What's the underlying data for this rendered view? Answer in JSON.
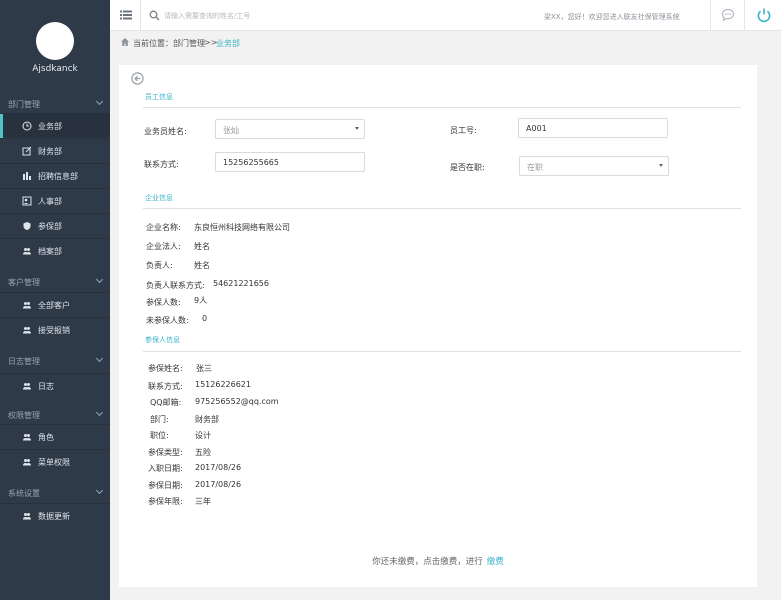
{
  "user": {
    "name": "Ajsdkanck"
  },
  "sidebar": {
    "groups": [
      {
        "label": "部门管理",
        "items": [
          {
            "label": "业务部",
            "icon": "clock-icon",
            "active": true
          },
          {
            "label": "财务部",
            "icon": "edit-icon"
          },
          {
            "label": "招聘信息部",
            "icon": "chart-icon"
          },
          {
            "label": "人事部",
            "icon": "id-card-icon"
          },
          {
            "label": "参保部",
            "icon": "shield-icon"
          },
          {
            "label": "档案部",
            "icon": "users-icon"
          }
        ]
      },
      {
        "label": "客户管理",
        "items": [
          {
            "label": "全部客户",
            "icon": "users-icon"
          },
          {
            "label": "接受报销",
            "icon": "users-icon"
          }
        ]
      },
      {
        "label": "日志管理",
        "items": [
          {
            "label": "日志",
            "icon": "users-icon"
          }
        ]
      },
      {
        "label": "权限管理",
        "items": [
          {
            "label": "角色",
            "icon": "users-icon"
          },
          {
            "label": "菜单权限",
            "icon": "users-icon"
          }
        ]
      },
      {
        "label": "系统设置",
        "items": [
          {
            "label": "数据更新",
            "icon": "users-icon"
          }
        ]
      }
    ]
  },
  "topbar": {
    "search_placeholder": "请输入需要查询的姓名/工号",
    "welcome": "梁XX，您好！欢迎您进入联友社保管理系统"
  },
  "breadcrumb": {
    "prefix": "当前位置：",
    "section": "部门管理",
    "separator": ">>",
    "current": "业务部"
  },
  "employee": {
    "title": "员工信息",
    "name_label": "业务员姓名:",
    "name_value": "张灿",
    "id_label": "员工号:",
    "id_value": "A001",
    "phone_label": "联系方式:",
    "phone_value": "15256255665",
    "status_label": "是否在职:",
    "status_value": "在职"
  },
  "company": {
    "title": "企业信息",
    "rows": [
      {
        "label": "企业名称:",
        "value": "东良恒州科技网络有限公司"
      },
      {
        "label": "企业法人:",
        "value": "姓名"
      },
      {
        "label": "负责人:",
        "value": "姓名"
      },
      {
        "label": "负责人联系方式:",
        "value": "54621221656"
      },
      {
        "label": "参保人数:",
        "value": "9人"
      },
      {
        "label": "未参保人数:",
        "value": "0"
      }
    ]
  },
  "insured": {
    "title": "参保人信息",
    "rows": [
      {
        "label": "参保姓名:",
        "value": "张三"
      },
      {
        "label": "联系方式:",
        "value": "15126226621"
      },
      {
        "label": "QQ邮箱:",
        "value": "975256552@qq.com"
      },
      {
        "label": "部门:",
        "value": "财务部"
      },
      {
        "label": "职位:",
        "value": "设计"
      },
      {
        "label": "参保类型:",
        "value": "五险"
      },
      {
        "label": "入职日期:",
        "value": "2017/08/26"
      },
      {
        "label": "参保日期:",
        "value": "2017/08/26"
      },
      {
        "label": "参保年限:",
        "value": "三年"
      }
    ]
  },
  "notice": {
    "text": "你还未缴费，点击缴费，进行",
    "link": "缴费"
  },
  "colors": {
    "sidebar_bg": "#2f3a48",
    "accent": "#3bb3c9"
  }
}
